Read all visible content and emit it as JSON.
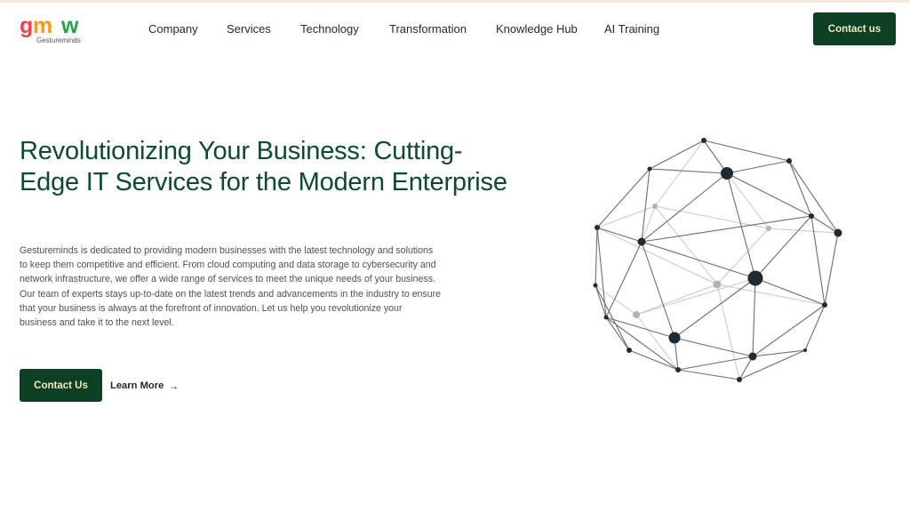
{
  "brand": {
    "logo_letters": "gmw",
    "name": "Gestureminds",
    "colors": {
      "g": "#e8434f",
      "m": "#f39a1c",
      "w": "#28a14a"
    }
  },
  "nav": {
    "items": [
      "Company",
      "Services",
      "Technology",
      "Transformation",
      "Knowledge Hub",
      "AI Training"
    ]
  },
  "header": {
    "contact_label": "Contact us"
  },
  "hero": {
    "title": "Revolutionizing Your Business: Cutting-Edge IT Services for the Modern Enterprise",
    "description": "Gestureminds is dedicated to providing modern businesses with the latest technology and solutions to keep them competitive and efficient. From cloud computing and data storage to cybersecurity and network infrastructure, we offer a wide range of services to meet the unique needs of your business. Our team of experts stays up-to-date on the latest trends and advancements in the industry to ensure that your business is always at the forefront of innovation. Let us help you revolutionize your business and take it to the next level.",
    "primary_cta": "Contact Us",
    "secondary_cta": "Learn More",
    "secondary_icon": "arrow-right-icon"
  },
  "theme": {
    "accent": "#0b4025",
    "accent_text": "#f4e9b8",
    "heading": "#0e4a2c",
    "illustration": "network-sphere"
  }
}
